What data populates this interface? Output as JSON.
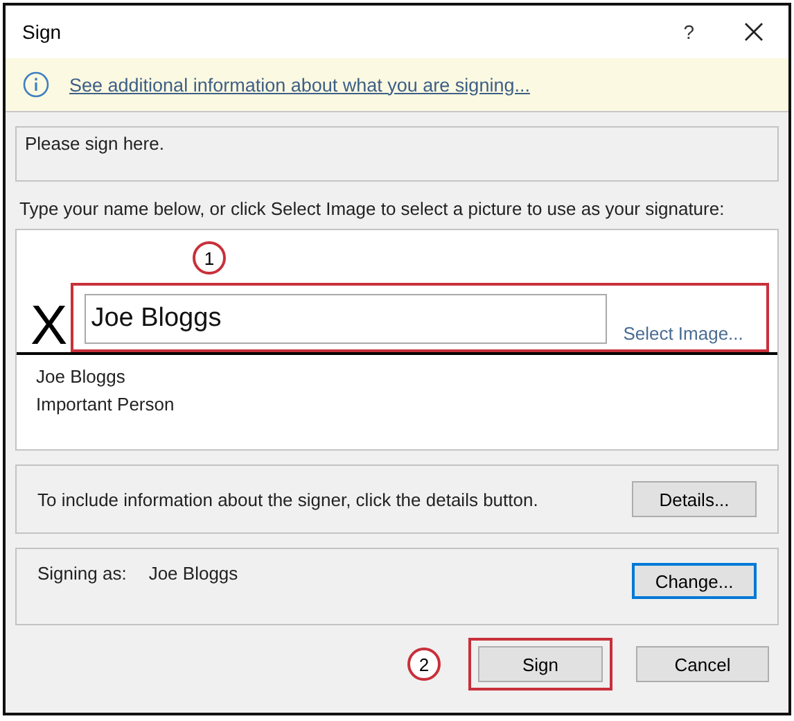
{
  "window": {
    "title": "Sign",
    "help": "?"
  },
  "info_bar": {
    "link": "See additional information about what you are signing..."
  },
  "instructions_box": {
    "text": "Please sign here."
  },
  "prompt": "Type your name below, or click Select Image to select a picture to use as your signature:",
  "signature": {
    "marker": "X",
    "value": "Joe Bloggs",
    "select_image": "Select Image...",
    "highlighted": true,
    "callout": "1",
    "signer_name": "Joe Bloggs",
    "signer_title": "Important Person"
  },
  "details": {
    "text": "To include information about the signer, click the details button.",
    "button": "Details..."
  },
  "signing_as": {
    "label": "Signing as:",
    "name": "Joe Bloggs",
    "button": {
      "label": "Change...",
      "focused": true
    }
  },
  "buttons": [
    {
      "label": "Sign",
      "highlighted": true,
      "callout": "2"
    },
    {
      "label": "Cancel",
      "highlighted": false
    }
  ]
}
